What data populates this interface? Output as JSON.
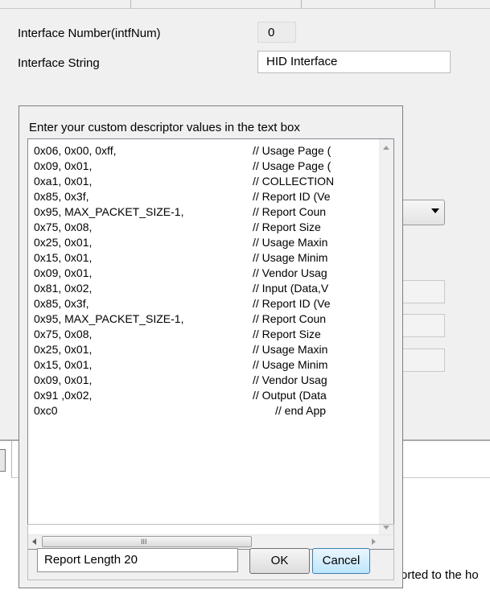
{
  "background": {
    "interface_number_label": "Interface Number(intfNum)",
    "interface_number_value": "0",
    "interface_string_label": "Interface String",
    "interface_string_value": "HID Interface",
    "bottom_partial_text": "orted to the ho"
  },
  "dialog": {
    "prompt": "Enter your custom descriptor values in the text box",
    "descriptor_lines": [
      {
        "code": "0x06, 0x00, 0xff,",
        "comment": "// Usage Page ("
      },
      {
        "code": "0x09, 0x01,",
        "comment": "// Usage Page ("
      },
      {
        "code": "0xa1, 0x01,",
        "comment": "// COLLECTION"
      },
      {
        "code": "0x85, 0x3f,",
        "comment": "// Report ID (Ve"
      },
      {
        "code": "0x95, MAX_PACKET_SIZE-1,",
        "comment": "// Report Coun"
      },
      {
        "code": "0x75, 0x08,",
        "comment": "// Report Size"
      },
      {
        "code": "0x25, 0x01,",
        "comment": "// Usage Maxin"
      },
      {
        "code": "0x15, 0x01,",
        "comment": "// Usage Minim"
      },
      {
        "code": "0x09, 0x01,",
        "comment": "// Vendor Usag"
      },
      {
        "code": "0x81, 0x02,",
        "comment": "// Input (Data,V"
      },
      {
        "code": "0x85, 0x3f,",
        "comment": "// Report ID (Ve"
      },
      {
        "code": "0x95, MAX_PACKET_SIZE-1,",
        "comment": "// Report Coun"
      },
      {
        "code": "0x75, 0x08,",
        "comment": "// Report Size"
      },
      {
        "code": "0x25, 0x01,",
        "comment": "// Usage Maxin"
      },
      {
        "code": "0x15, 0x01,",
        "comment": "// Usage Minim"
      },
      {
        "code": "0x09, 0x01,",
        "comment": "// Vendor Usag"
      },
      {
        "code": "0x91 ,0x02,",
        "comment": "// Output (Data"
      },
      {
        "code": "0xc0",
        "comment": "// end App"
      }
    ],
    "hscroll_grip": "III",
    "report_length_value": "Report Length 20",
    "ok_label": "OK",
    "cancel_label": "Cancel"
  },
  "colors": {
    "window_bg": "#f0f0f0",
    "cancel_focus_border": "#3c7fb1"
  }
}
